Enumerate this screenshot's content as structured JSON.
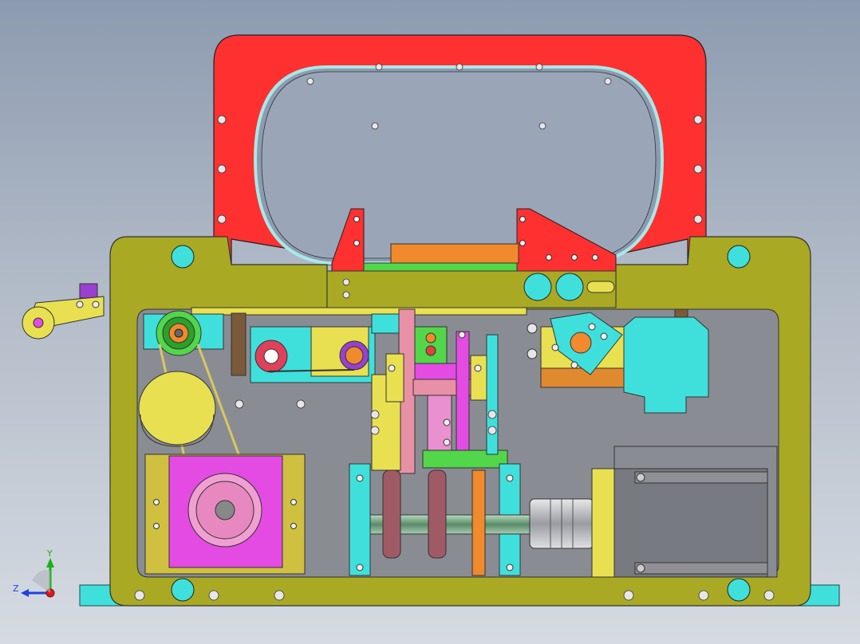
{
  "viewport": {
    "background_top": "#8d9bb0",
    "background_bottom": "#d6dbe2"
  },
  "colors": {
    "frame_red": "#ff3030",
    "base_olive": "#a9a924",
    "back_plate": "#8a8c93",
    "cyan": "#3fe0dc",
    "magenta": "#e34be3",
    "yellow": "#e8e050",
    "green": "#52d64a",
    "orange": "#f08a2c",
    "pink": "#e890a6",
    "motor_gray": "#777a80"
  },
  "triad": {
    "y_label": "Y",
    "z_label": "Z",
    "y_color": "#18b018",
    "z_color": "#2040e0",
    "x_color": "#e01818"
  },
  "icons": [
    "coordinate-triad-icon"
  ]
}
